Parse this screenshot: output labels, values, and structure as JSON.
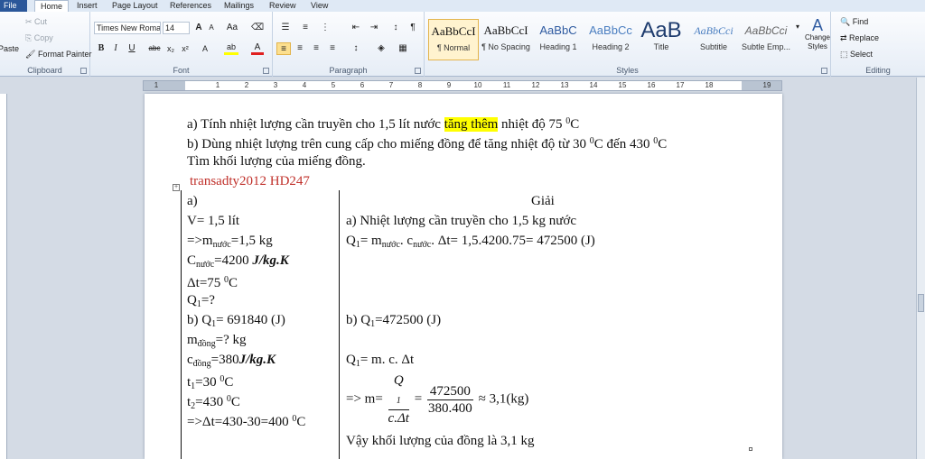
{
  "tabs": [
    "File",
    "Home",
    "Insert",
    "Page Layout",
    "Mailings",
    "References",
    "Review",
    "View"
  ],
  "clipboard": {
    "paste": "Paste",
    "cut": "Cut",
    "copy": "Copy",
    "format_painter": "Format Painter",
    "label": "Clipboard"
  },
  "font": {
    "name": "Times New Roma",
    "size": "14",
    "label": "Font",
    "grow": "A",
    "shrink": "A",
    "case": "Aa",
    "bold": "B",
    "italic": "I",
    "underline": "U",
    "strike": "abc",
    "sub": "x₂",
    "sup": "x²",
    "highlight": "ab",
    "color": "A"
  },
  "paragraph": {
    "label": "Paragraph",
    "pilcrow": "¶"
  },
  "styles": {
    "label": "Styles",
    "items": [
      {
        "sample": "AaBbCcI",
        "name": "¶ Normal"
      },
      {
        "sample": "AaBbCcI",
        "name": "¶ No Spacing"
      },
      {
        "sample": "AaBbC",
        "name": "Heading 1"
      },
      {
        "sample": "AaBbCc",
        "name": "Heading 2"
      },
      {
        "sample": "AaB",
        "name": "Title"
      },
      {
        "sample": "AaBbCci",
        "name": "Subtitle"
      },
      {
        "sample": "AaBbCci",
        "name": "Subtle Emp..."
      }
    ],
    "change_styles": "Change Styles"
  },
  "editing": {
    "find": "Find",
    "replace": "Replace",
    "select": "Select",
    "label": "Editing"
  },
  "ruler": {
    "numbers": [
      "1",
      "1",
      "2",
      "3",
      "4",
      "5",
      "6",
      "7",
      "8",
      "9",
      "10",
      "11",
      "12",
      "13",
      "14",
      "15",
      "16",
      "17",
      "18",
      "19"
    ]
  },
  "doc": {
    "line_a_pre": "a) Tính nhiệt lượng cần truyền cho 1,5 lít nước ",
    "line_a_hl": "tăng thêm",
    "line_a_post": " nhiệt độ 75 ",
    "line_b": "b) Dùng nhiệt lượng trên cung cấp cho miếng đồng để tăng nhiệt độ từ 30 ",
    "line_b_mid": "C đến 430 ",
    "line_c": "Tìm khối lượng của miếng đồng.",
    "watermark": "transadty2012 HD247",
    "deg": "0",
    "c_unit": "C",
    "left": {
      "a": "a)",
      "v": "V= 1,5 lít",
      "m_pre": "=>m",
      "m_sub": "nước",
      "m_post": "=1,5 kg",
      "c_pre": "C",
      "c_sub": "nước",
      "c_val": "=4200",
      "c_unit": "J/kg.K",
      "dt": "Δt=75 ",
      "q_pre": "Q",
      "q_sub": "1",
      "q_post": "=?",
      "b_pre": "b) Q",
      "b_post": "= 691840  (J)",
      "md_pre": "m",
      "md_sub": "đồng",
      "md_post": "=? kg",
      "cd_pre": "c",
      "cd_sub": "đồng",
      "cd_val": "=380",
      "cd_unit": "J/kg.K",
      "t1_pre": "t",
      "t1_sub": "1",
      "t1_post": "=30 ",
      "t2_pre": "t",
      "t2_sub": "2",
      "t2_post": "=430 ",
      "dt2": "=>Δt=430-30=400 "
    },
    "right": {
      "title": "Giải",
      "a_line": "a) Nhiệt lượng cần truyền cho 1,5 kg nước",
      "q_pre": "Q",
      "q_sub": "1",
      "q_mid": "= m",
      "q_sub2": "nước",
      "q_mid2": ". c",
      "q_sub3": "nước",
      "q_post": ". Δt= 1,5.4200.75= 472500 (J)",
      "b_pre": "b) Q",
      "b_post": "=472500 (J)",
      "f_pre": "Q",
      "f_post": "= m. c. Δt",
      "m_pre": "=> m=",
      "frac1_num": "Q",
      "frac1_den": "c.Δt",
      "frac2_num": "472500",
      "frac2_den": "380.400",
      "approx": "≈ 3,1(kg)",
      "result": "Vậy khối lượng của đồng là 3,1 kg"
    }
  }
}
